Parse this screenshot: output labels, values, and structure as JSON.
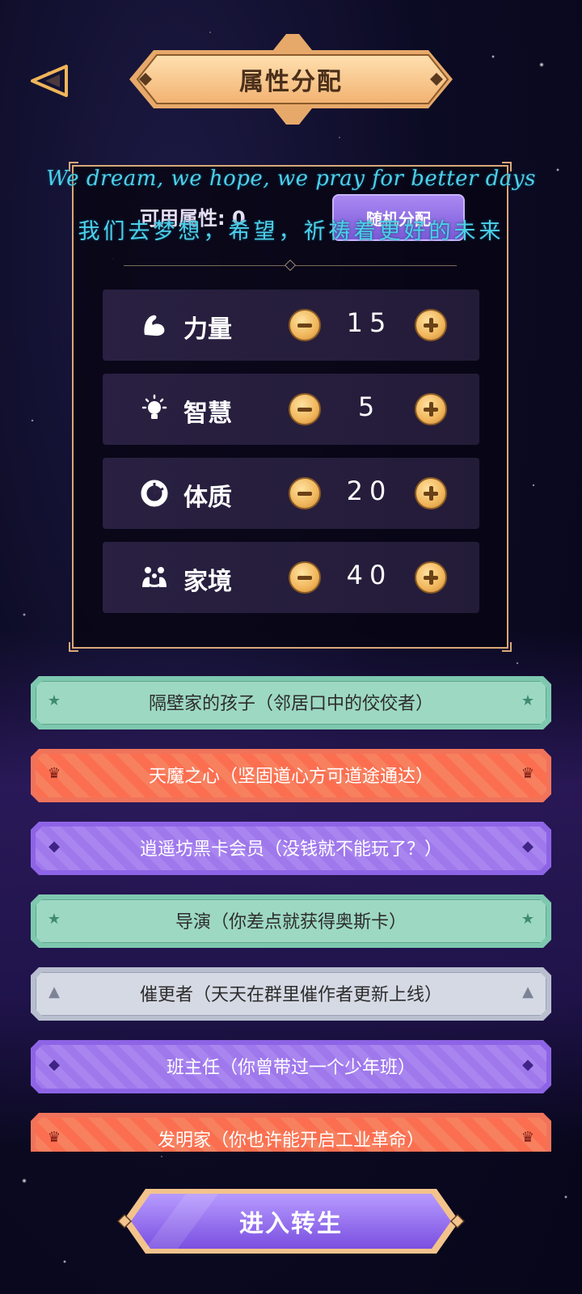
{
  "header": {
    "title": "属性分配",
    "back_icon": "back-triangle-icon"
  },
  "panel": {
    "available_label": "可用属性: 0",
    "random_button": "随机分配",
    "attributes": [
      {
        "name": "力量",
        "value": "15",
        "icon": "strength-arm-icon"
      },
      {
        "name": "智慧",
        "value": "5",
        "icon": "lightbulb-icon"
      },
      {
        "name": "体质",
        "value": "20",
        "icon": "constitution-ring-icon"
      },
      {
        "name": "家境",
        "value": "40",
        "icon": "family-people-icon"
      }
    ]
  },
  "overlay": {
    "lyric_en": "We dream, we hope, we pray for better days",
    "lyric_cn": "我们去梦想，希望，祈祷着更好的未来"
  },
  "talents": [
    {
      "label": "隔壁家的孩子（邻居口中的佼佼者）",
      "rarity": "green"
    },
    {
      "label": "天魔之心（坚固道心方可道途通达）",
      "rarity": "orange"
    },
    {
      "label": "逍遥坊黑卡会员（没钱就不能玩了？）",
      "rarity": "purple"
    },
    {
      "label": "导演（你差点就获得奥斯卡）",
      "rarity": "green"
    },
    {
      "label": "催更者（天天在群里催作者更新上线）",
      "rarity": "gray"
    },
    {
      "label": "班主任（你曾带过一个少年班）",
      "rarity": "purple"
    },
    {
      "label": "发明家（你也许能开启工业革命）",
      "rarity": "orange"
    }
  ],
  "footer": {
    "enter_button": "进入转生"
  },
  "colors": {
    "green": "#9dd8c3",
    "orange": "#fb6f50",
    "purple": "#9f78ec",
    "gray": "#d5d9e4",
    "gold": "#f0b55a",
    "lyric": "#4dd0ea"
  }
}
